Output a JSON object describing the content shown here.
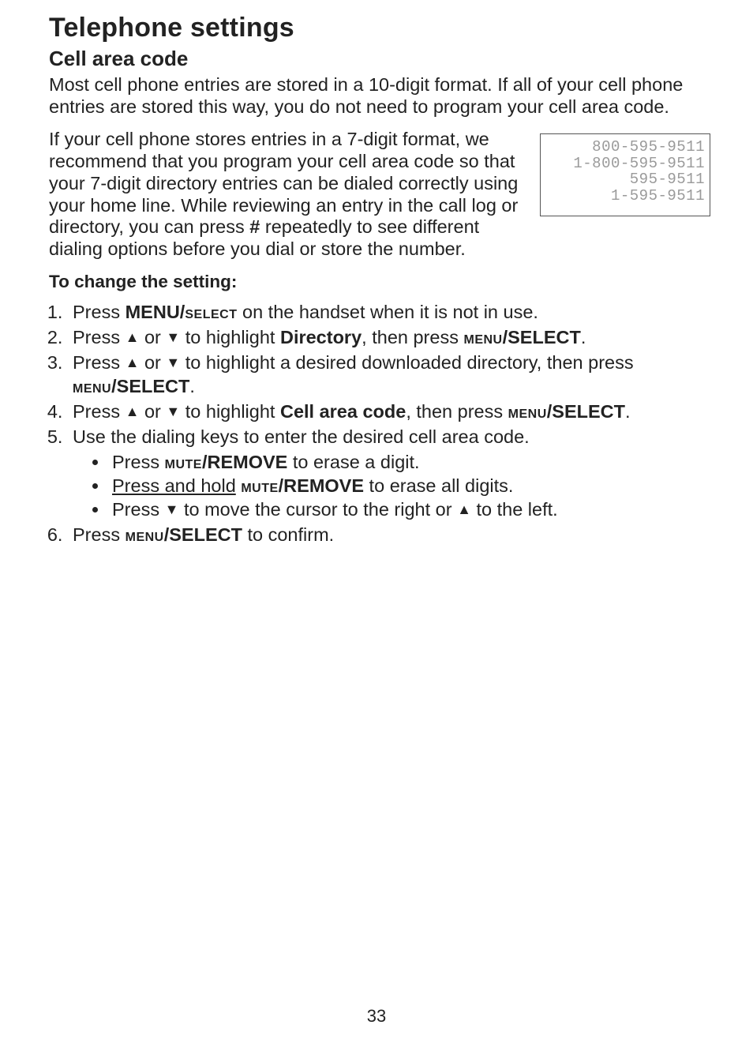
{
  "title": "Telephone settings",
  "section_heading": "Cell area code",
  "intro": "Most cell phone entries are stored in a 10-digit format. If all of your cell phone entries are stored this way, you do not need to program your cell area code.",
  "para_a": "If your cell phone stores entries in a 7-digit format, we recommend that you program your cell area code so that your 7-digit directory entries can be dialed correctly using your home line. While reviewing an entry in the call log or directory, you can press ",
  "para_hash": "#",
  "para_b": " repeatedly to see different dialing options before you dial or store the number.",
  "lcd": {
    "l1": "800-595-9511",
    "l2": "1-800-595-9511",
    "l3": "595-9511",
    "l4": "1-595-9511"
  },
  "subheading": "To change the setting:",
  "tokens": {
    "press": "Press ",
    "menu_big": "MENU/",
    "select_sc": "select",
    "menu_sc": "menu",
    "select_big": "/SELECT",
    "mute_sc": "mute",
    "remove_big": "/REMOVE",
    "or": " or ",
    "up": "▲",
    "down": "▼",
    "directory": "Directory",
    "cell_area_code": "Cell area code"
  },
  "steps": {
    "s1_tail": " on the handset when it is not in use.",
    "s2_mid": " to highlight ",
    "s2_tail": ", then press ",
    "s2_end": ".",
    "s3_mid": " to highlight a desired downloaded directory, then press ",
    "s3_end": ".",
    "s4_mid": " to highlight ",
    "s4_tail": ", then press ",
    "s4_end": ".",
    "s5": "Use the dialing keys to enter the desired cell area code.",
    "b1_tail": " to erase a digit.",
    "b2_lead": "Press and hold",
    "b2_tail": " to erase all digits.",
    "b3_mid": " to move the cursor to the right or ",
    "b3_tail": " to the left.",
    "s6_tail": " to confirm."
  },
  "page_number": "33"
}
